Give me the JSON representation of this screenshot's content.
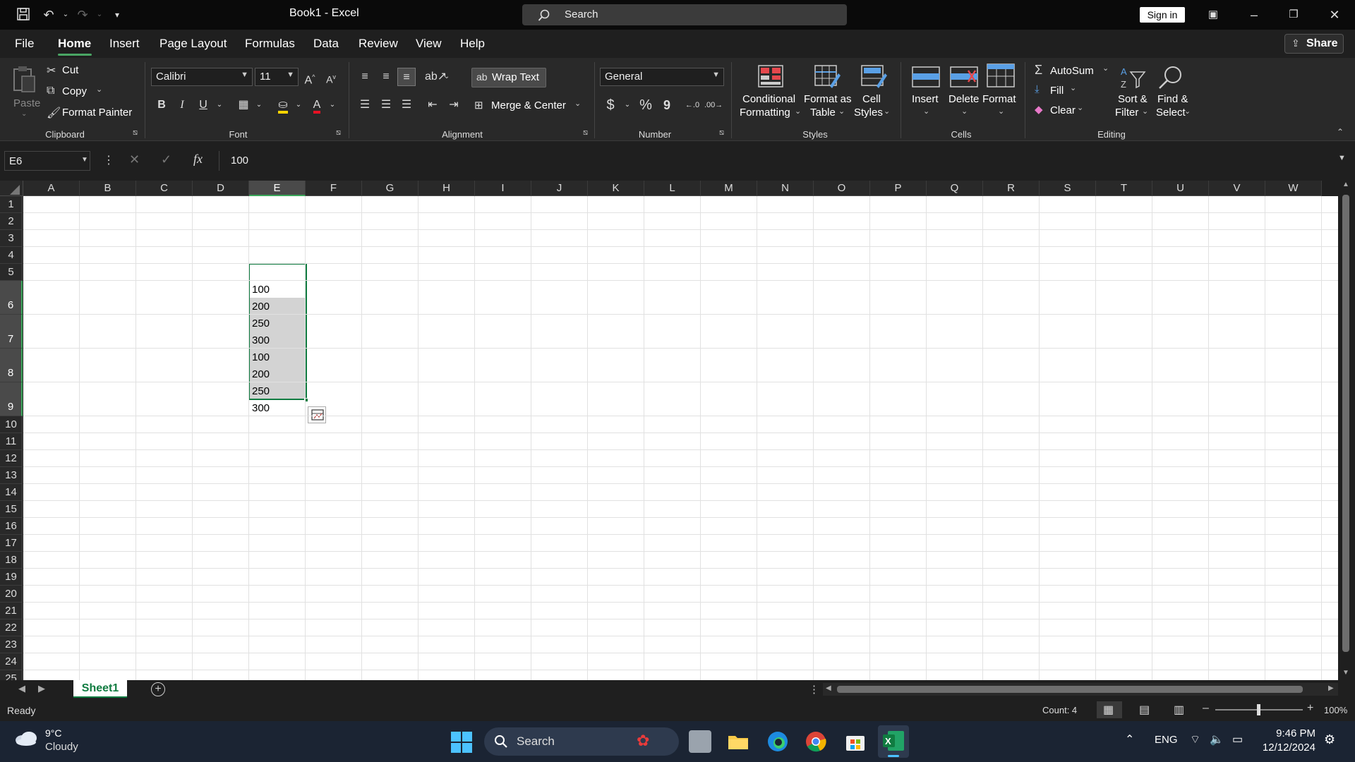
{
  "window": {
    "title": "Book1  -  Excel",
    "search_placeholder": "Search",
    "sign_in": "Sign in"
  },
  "menu": {
    "tabs": [
      "File",
      "Home",
      "Insert",
      "Page Layout",
      "Formulas",
      "Data",
      "Review",
      "View",
      "Help"
    ],
    "active": "Home",
    "share": "Share"
  },
  "ribbon": {
    "clipboard": {
      "paste": "Paste",
      "cut": "Cut",
      "copy": "Copy",
      "format_painter": "Format Painter",
      "group": "Clipboard"
    },
    "font": {
      "name": "Calibri",
      "size": "11",
      "bold": "B",
      "italic": "I",
      "underline": "U",
      "group": "Font"
    },
    "alignment": {
      "wrap_text": "Wrap Text",
      "merge_center": "Merge & Center",
      "group": "Alignment"
    },
    "number": {
      "format": "General",
      "currency": "$",
      "percent": "%",
      "comma": "9",
      "group": "Number"
    },
    "styles": {
      "conditional_1": "Conditional",
      "conditional_2": "Formatting",
      "format_table_1": "Format as",
      "format_table_2": "Table",
      "cell_styles_1": "Cell",
      "cell_styles_2": "Styles",
      "group": "Styles"
    },
    "cells": {
      "insert": "Insert",
      "delete": "Delete",
      "format": "Format",
      "group": "Cells"
    },
    "editing": {
      "autosum": "AutoSum",
      "fill": "Fill",
      "clear": "Clear",
      "sort_1": "Sort &",
      "sort_2": "Filter",
      "find_1": "Find &",
      "find_2": "Select",
      "group": "Editing"
    }
  },
  "formula_bar": {
    "name_box": "E6",
    "fx": "fx",
    "value": "100"
  },
  "grid": {
    "columns": [
      "A",
      "B",
      "C",
      "D",
      "E",
      "F",
      "G",
      "H",
      "I",
      "J",
      "K",
      "L",
      "M",
      "N",
      "O",
      "P",
      "Q",
      "R",
      "S",
      "T",
      "U",
      "V",
      "W"
    ],
    "selected_column": "E",
    "rows": [
      "1",
      "2",
      "3",
      "4",
      "5",
      "6",
      "7",
      "8",
      "9",
      "10",
      "11",
      "12",
      "13",
      "14",
      "15",
      "16",
      "17",
      "18",
      "19",
      "20",
      "21",
      "22",
      "23",
      "24",
      "25"
    ],
    "cell_values": [
      "100",
      "200",
      "250",
      "300",
      "100",
      "200",
      "250",
      "300"
    ]
  },
  "sheets": {
    "tabs": [
      "Sheet1"
    ],
    "active": "Sheet1"
  },
  "status": {
    "ready": "Ready",
    "count": "Count: 4",
    "zoom": "100%"
  },
  "taskbar": {
    "temp": "9°C",
    "weather": "Cloudy",
    "search": "Search",
    "lang": "ENG",
    "time": "9:46 PM",
    "date": "12/12/2024"
  }
}
